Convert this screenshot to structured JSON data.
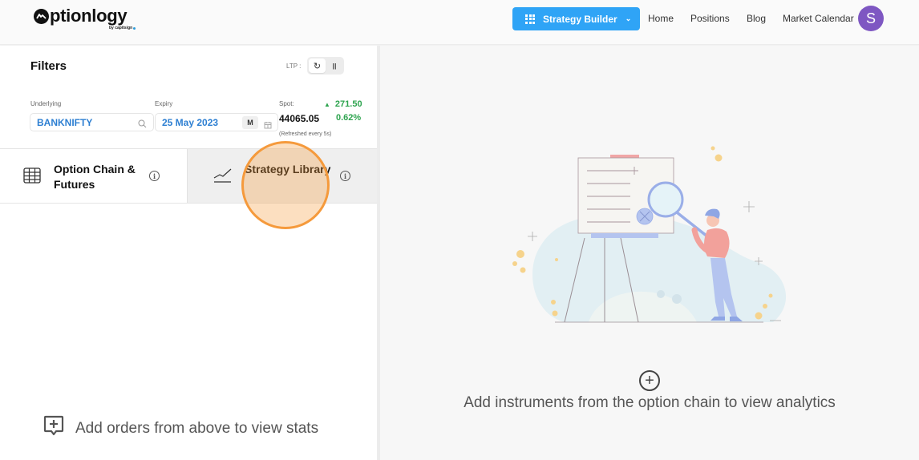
{
  "header": {
    "logo_text": "ptionlogy",
    "logo_subtext": "by capitsign",
    "strategy_builder_label": "Strategy Builder",
    "nav": [
      "Home",
      "Positions",
      "Blog",
      "Market Calendar"
    ],
    "avatar_initial": "S",
    "accent_color": "#2fa4f6",
    "avatar_color": "#7e57c2"
  },
  "filters": {
    "title": "Filters",
    "ltp_label": "LTP :",
    "underlying_label": "Underlying",
    "underlying_value": "BANKNIFTY",
    "expiry_label": "Expiry",
    "expiry_value": "25 May 2023",
    "expiry_badge": "M",
    "spot_label": "Spot:",
    "spot_value": "44065.05",
    "change_abs": "271.50",
    "change_pct": "0.62%",
    "change_color": "#2ea44f",
    "refresh_note": "(Refreshed every 5s)"
  },
  "tabs": [
    {
      "label": "Option Chain & Futures",
      "icon": "table-icon",
      "active": true
    },
    {
      "label": "Strategy Library",
      "icon": "chart-line-icon",
      "active": false
    }
  ],
  "left_empty": {
    "message": "Add orders from above to view stats"
  },
  "right_empty": {
    "message": "Add instruments from the option chain to view analytics"
  }
}
